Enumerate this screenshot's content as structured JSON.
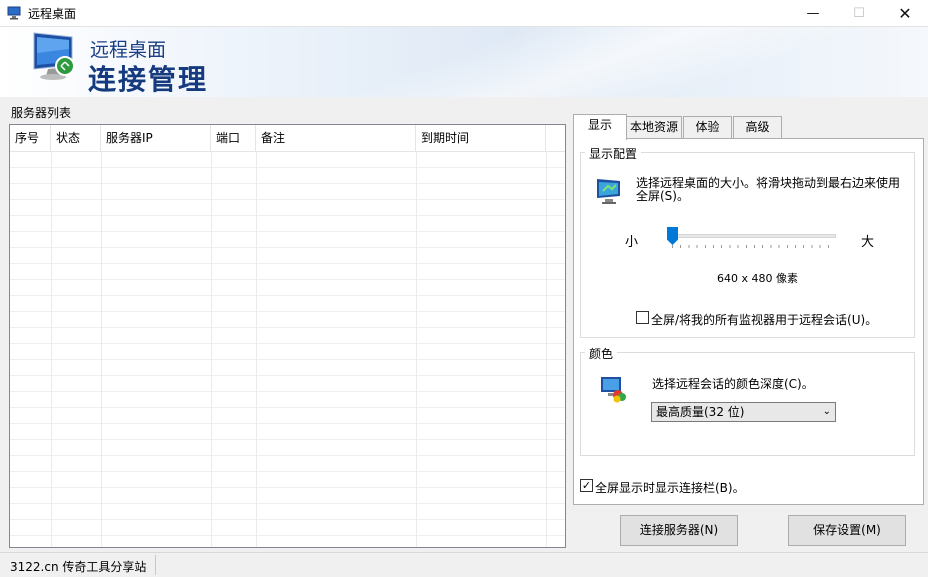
{
  "window": {
    "title": "远程桌面",
    "controls": {
      "minimize": "—",
      "maximize": "☐",
      "close": "✕"
    }
  },
  "banner": {
    "subtitle": "远程桌面",
    "title": "连接管理",
    "icon": "remote-desktop-monitor-icon"
  },
  "server_list": {
    "label": "服务器列表",
    "columns": [
      "序号",
      "状态",
      "服务器IP",
      "端口",
      "备注",
      "到期时间"
    ],
    "rows": []
  },
  "tabs": [
    {
      "label": "显示",
      "active": true
    },
    {
      "label": "本地资源",
      "active": false
    },
    {
      "label": "体验",
      "active": false
    },
    {
      "label": "高级",
      "active": false
    }
  ],
  "display": {
    "group_title": "显示配置",
    "description": "选择远程桌面的大小。将滑块拖动到最右边来使用全屏(S)。",
    "slider_min_label": "小",
    "slider_max_label": "大",
    "resolution_text": "640 x 480 像素",
    "slider_level": 0,
    "multi_monitor_label": "全屏/将我的所有监视器用于远程会话(U)。",
    "multi_monitor_checked": false
  },
  "color": {
    "group_title": "颜色",
    "description": "选择远程会话的颜色深度(C)。",
    "selected": "最高质量(32 位)"
  },
  "connection_bar": {
    "label": "全屏显示时显示连接栏(B)。",
    "checked": true,
    "check_mark": "✓"
  },
  "buttons": {
    "connect": "连接服务器(N)",
    "save": "保存设置(M)"
  },
  "status": {
    "text": "3122.cn 传奇工具分享站"
  },
  "colors": {
    "banner_text": "#153a7e",
    "slider_thumb": "#0078d7"
  }
}
